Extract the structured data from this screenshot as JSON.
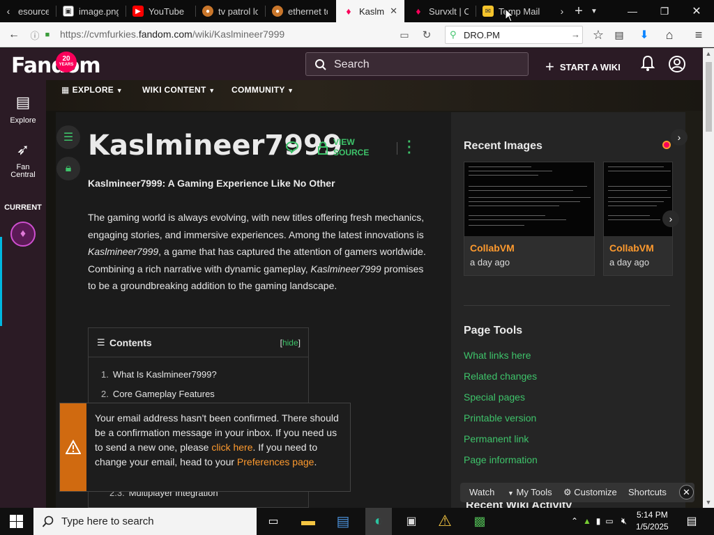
{
  "browser": {
    "tabs": [
      {
        "label": "esource H",
        "icon": "page-icon",
        "active": false
      },
      {
        "label": "image.png",
        "icon": "image-icon",
        "active": false
      },
      {
        "label": "YouTube",
        "icon": "youtube-icon",
        "active": false
      },
      {
        "label": "tv patrol lo",
        "icon": "search-engine-icon",
        "active": false
      },
      {
        "label": "ethernet to",
        "icon": "search-engine-icon",
        "active": false
      },
      {
        "label": "Kaslmi",
        "icon": "fandom-icon",
        "active": true
      },
      {
        "label": "Survxlt | Co",
        "icon": "fandom-icon",
        "active": false
      },
      {
        "label": "Temp Mail",
        "icon": "mail-icon",
        "active": false
      }
    ],
    "url_prefix": "https://cvmfurkies.",
    "url_domain": "fandom.com",
    "url_path": "/wiki/Kaslmineer7999",
    "search_value": "DRO.PM",
    "colors": {
      "tab_strip": "#0c0c0c",
      "navbar": "#f6f6f6"
    }
  },
  "fandom": {
    "logo_text": "Fandom",
    "logo_badge_top": "20",
    "logo_badge_bottom": "YEARS",
    "search_placeholder": "Search",
    "start_wiki": "START A WIKI",
    "brand_color": "#fa005a",
    "link_color": "#3ec36a",
    "accent_color": "#fe9a2e"
  },
  "rail": {
    "explore": "Explore",
    "fan_central_1": "Fan",
    "fan_central_2": "Central",
    "current": "CURRENT"
  },
  "community_nav": {
    "explore": "EXPLORE",
    "wiki_content": "WIKI CONTENT",
    "community": "COMMUNITY"
  },
  "article": {
    "title": "Kaslmineer7999",
    "view_source_1": "VIEW",
    "view_source_2": "SOURCE",
    "subheading": "Kaslmineer7999: A Gaming Experience Like No Other",
    "para_1": "The gaming world is always evolving, with new titles offering fresh mechanics, engaging stories, and immersive experiences. Among the latest innovations is ",
    "para_italic_1": "Kaslmineer7999",
    "para_2": ", a game that has captured the attention of gamers worldwide. Combining a rich narrative with dynamic gameplay, ",
    "para_italic_2": "Kaslmineer7999",
    "para_3": " promises to be a groundbreaking addition to the gaming landscape."
  },
  "toc": {
    "title": "Contents",
    "hide_label": "hide",
    "items": [
      {
        "num": "1.",
        "label": "What Is Kaslmineer7999?"
      },
      {
        "num": "2.",
        "label": "Core Gameplay Features"
      },
      {
        "num": "2.3.",
        "label": "Multiplayer Integration"
      }
    ]
  },
  "banner": {
    "text_1": "Your email address hasn't been confirmed. There should be a confirmation message in your inbox. If you need us to send a new one, please ",
    "link_1": "click here",
    "text_2": ". If you need to change your email, head to your ",
    "link_2": "Preferences page",
    "text_3": "."
  },
  "right_rail": {
    "recent_images_title": "Recent Images",
    "images": [
      {
        "caption": "CollabVM",
        "time": "a day ago"
      },
      {
        "caption": "CollabVM",
        "time": "a day ago"
      }
    ],
    "page_tools_title": "Page Tools",
    "tools": [
      "What links here",
      "Related changes",
      "Special pages",
      "Printable version",
      "Permanent link",
      "Page information"
    ],
    "next_heading": "Recent Wiki Activity"
  },
  "bottom_toolbar": {
    "watch": "Watch",
    "my_tools": "My Tools",
    "customize": "Customize",
    "shortcuts": "Shortcuts"
  },
  "taskbar": {
    "search_placeholder": "Type here to search",
    "time": "5:14 PM",
    "date": "1/5/2025"
  }
}
